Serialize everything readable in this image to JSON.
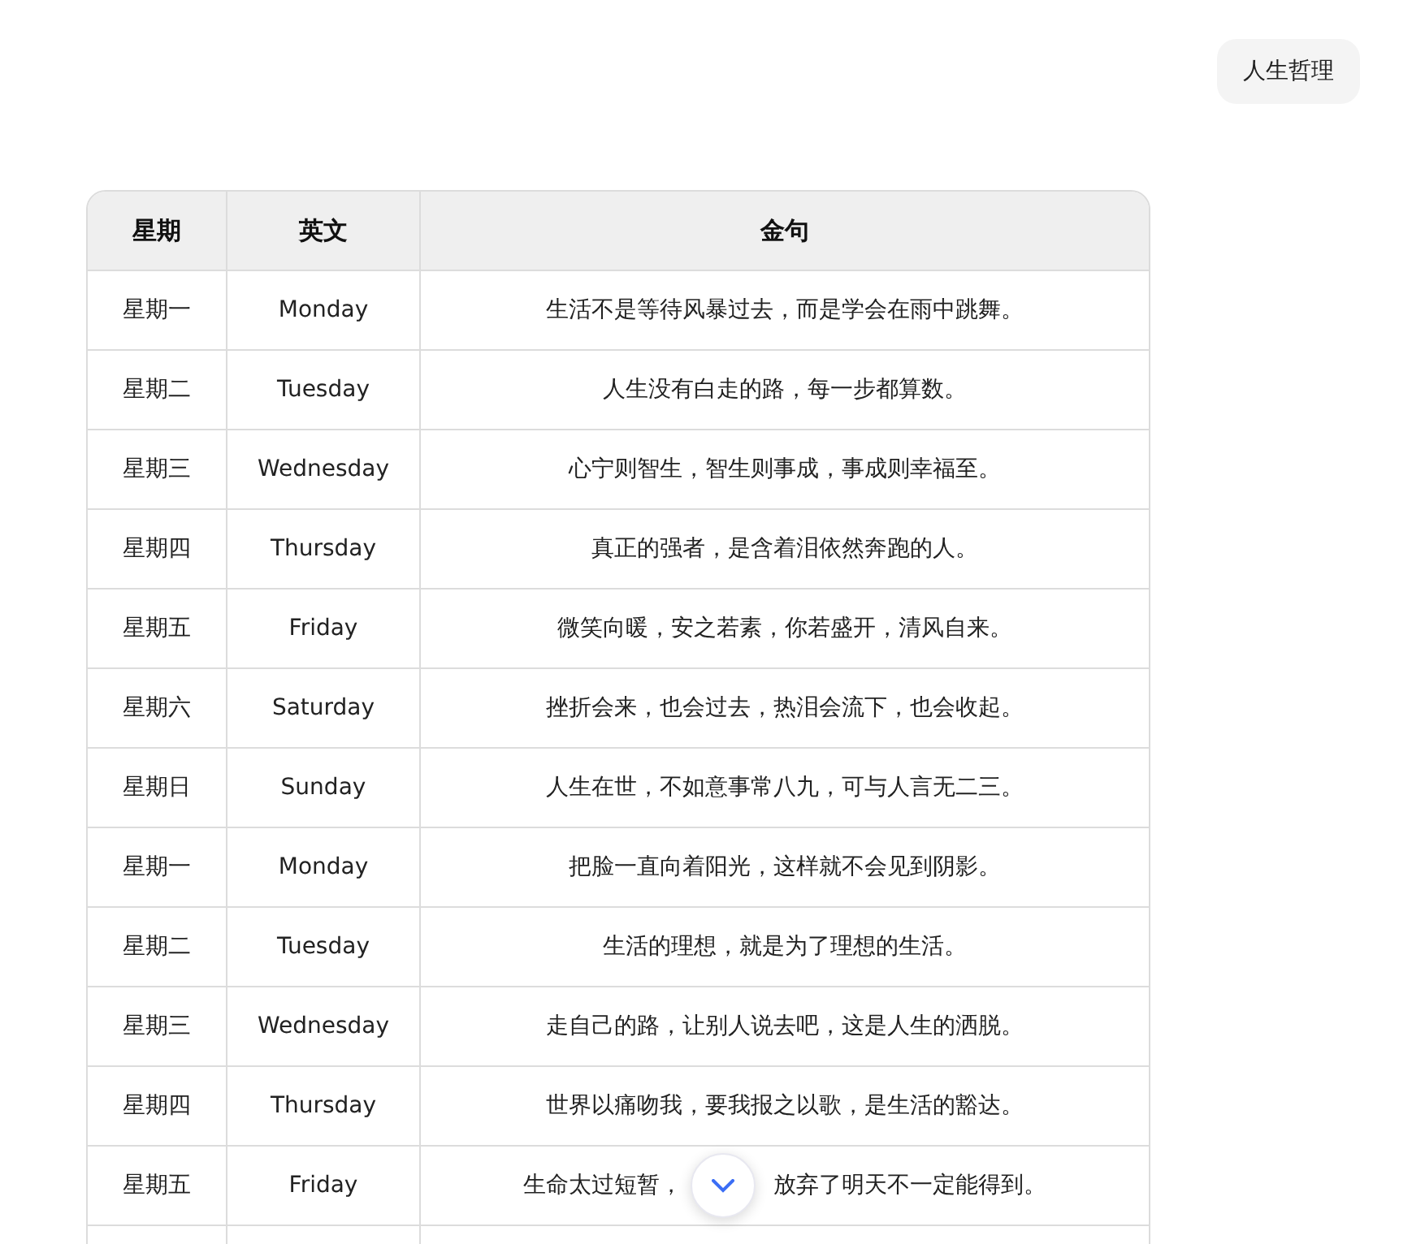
{
  "topic_chip": "人生哲理",
  "table": {
    "columns": [
      "星期",
      "英文",
      "金句"
    ],
    "rows": [
      {
        "day": "星期一",
        "english": "Monday",
        "quote_parts": [
          "生活不是等待风暴过去，而是学会在雨中跳舞。"
        ]
      },
      {
        "day": "星期二",
        "english": "Tuesday",
        "quote_parts": [
          "人生没有白走的路，每一步都算数。"
        ]
      },
      {
        "day": "星期三",
        "english": "Wednesday",
        "quote_parts": [
          "心宁则智生，智生则事成，事成则幸福至。"
        ]
      },
      {
        "day": "星期四",
        "english": "Thursday",
        "quote_parts": [
          "真正的强者，是含着泪依然奔跑的人。"
        ]
      },
      {
        "day": "星期五",
        "english": "Friday",
        "quote_parts": [
          "微笑向暖，安之若素，你若盛开，清风自来。"
        ]
      },
      {
        "day": "星期六",
        "english": "Saturday",
        "quote_parts": [
          "挫折会来，也会过去，热泪会流下，也会收起。"
        ]
      },
      {
        "day": "星期日",
        "english": "Sunday",
        "quote_parts": [
          "人生在世，不如意事常八九，可与人言无二三。"
        ]
      },
      {
        "day": "星期一",
        "english": "Monday",
        "quote_parts": [
          "把脸一直向着阳光，这样就不会见到阴影。"
        ]
      },
      {
        "day": "星期二",
        "english": "Tuesday",
        "quote_parts": [
          "生活的理想，就是为了理想的生活。"
        ]
      },
      {
        "day": "星期三",
        "english": "Wednesday",
        "quote_parts": [
          "走自己的路，让别人说去吧，这是人生的洒脱。"
        ]
      },
      {
        "day": "星期四",
        "english": "Thursday",
        "quote_parts": [
          "世界以痛吻我，要我报之以歌，是生活的豁达。"
        ]
      },
      {
        "day": "星期五",
        "english": "Friday",
        "quote_parts": [
          "生命太过短暂，",
          "放弃了明天不一定能得到。"
        ]
      }
    ]
  }
}
